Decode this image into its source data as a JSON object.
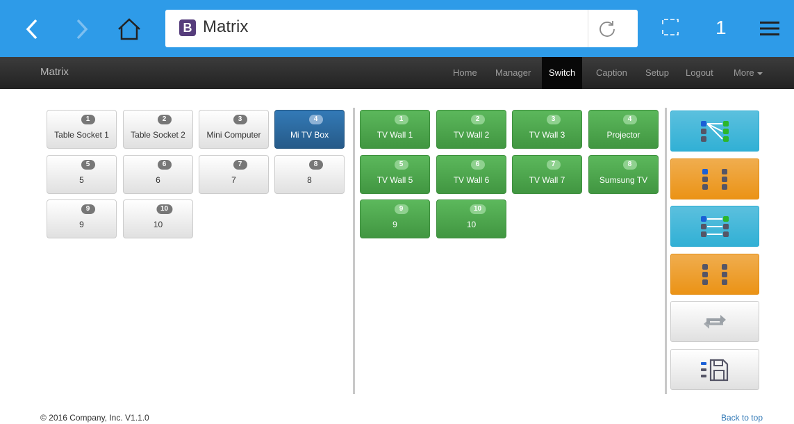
{
  "browser": {
    "url_text": "Matrix",
    "logo_letter": "B",
    "tab_count": "1"
  },
  "navbar": {
    "brand": "Matrix",
    "items": [
      {
        "label": "Home"
      },
      {
        "label": "Manager"
      },
      {
        "label": "Switch",
        "active": true
      },
      {
        "label": "Caption"
      },
      {
        "label": "Setup"
      },
      {
        "label": "Logout"
      },
      {
        "label": "More"
      }
    ]
  },
  "inputs": [
    {
      "num": "1",
      "label": "Table Socket 1"
    },
    {
      "num": "2",
      "label": "Table Socket 2"
    },
    {
      "num": "3",
      "label": "Mini Computer"
    },
    {
      "num": "4",
      "label": "Mi TV Box",
      "selected": true
    },
    {
      "num": "5",
      "label": "5"
    },
    {
      "num": "6",
      "label": "6"
    },
    {
      "num": "7",
      "label": "7"
    },
    {
      "num": "8",
      "label": "8"
    },
    {
      "num": "9",
      "label": "9"
    },
    {
      "num": "10",
      "label": "10"
    }
  ],
  "outputs": [
    {
      "num": "1",
      "label": "TV Wall 1"
    },
    {
      "num": "2",
      "label": "TV Wall 2"
    },
    {
      "num": "3",
      "label": "TV Wall 3"
    },
    {
      "num": "4",
      "label": "Projector"
    },
    {
      "num": "5",
      "label": "TV Wall 5"
    },
    {
      "num": "6",
      "label": "TV Wall 6"
    },
    {
      "num": "7",
      "label": "TV Wall 7"
    },
    {
      "num": "8",
      "label": "Sumsung TV"
    },
    {
      "num": "9",
      "label": "9"
    },
    {
      "num": "10",
      "label": "10"
    }
  ],
  "actions": [
    {
      "name": "route-many-icon",
      "color": "blue"
    },
    {
      "name": "clear-all-icon",
      "color": "orange"
    },
    {
      "name": "route-one-to-one-icon",
      "color": "blue"
    },
    {
      "name": "disconnect-all-icon",
      "color": "orange"
    },
    {
      "name": "refresh-icon",
      "color": "grey"
    },
    {
      "name": "save-scene-icon",
      "color": "grey"
    }
  ],
  "footer": {
    "copyright": "© 2016 Company, Inc. V1.1.0",
    "back_to_top": "Back to top"
  }
}
